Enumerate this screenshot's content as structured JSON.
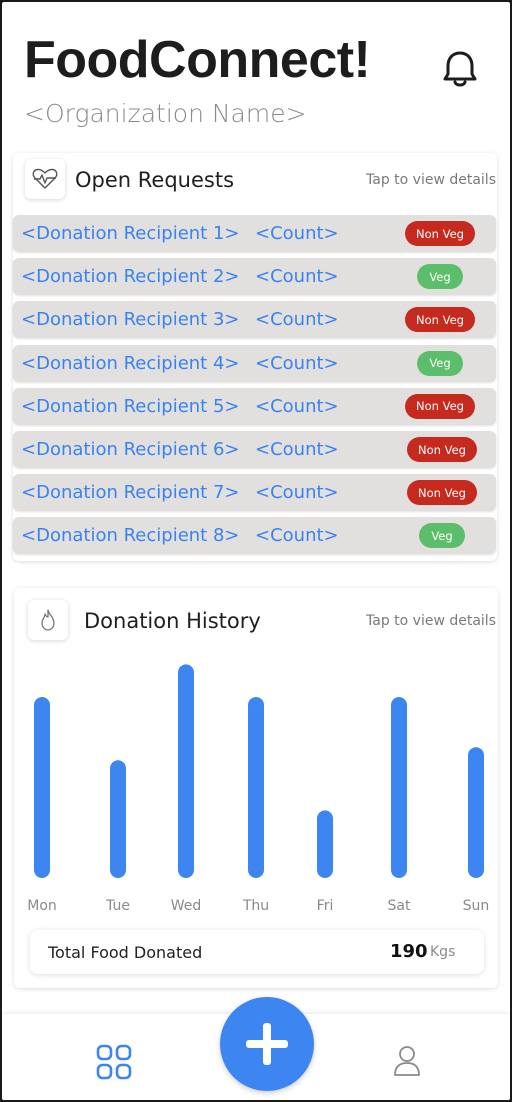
{
  "header": {
    "app_title": "FoodConnect!",
    "org_name": "<Organization Name>"
  },
  "requests": {
    "title": "Open Requests",
    "hint": "Tap to view details",
    "items": [
      {
        "recipient": "<Donation Recipient 1>",
        "count": "<Count>",
        "tag": "Non Veg",
        "kind": "nonveg"
      },
      {
        "recipient": "<Donation Recipient 2>",
        "count": "<Count>",
        "tag": "Veg",
        "kind": "veg"
      },
      {
        "recipient": "<Donation Recipient 3>",
        "count": "<Count>",
        "tag": "Non Veg",
        "kind": "nonveg"
      },
      {
        "recipient": "<Donation Recipient 4>",
        "count": "<Count>",
        "tag": "Veg",
        "kind": "veg"
      },
      {
        "recipient": "<Donation Recipient 5>",
        "count": "<Count>",
        "tag": "Non Veg",
        "kind": "nonveg"
      },
      {
        "recipient": "<Donation Recipient 6>",
        "count": "<Count>",
        "tag": "Non Veg",
        "kind": "nonveg"
      },
      {
        "recipient": "<Donation Recipient 7>",
        "count": "<Count>",
        "tag": "Non Veg",
        "kind": "nonveg"
      },
      {
        "recipient": "<Donation Recipient 8>",
        "count": "<Count>",
        "tag": "Veg",
        "kind": "veg"
      }
    ]
  },
  "history": {
    "title": "Donation History",
    "hint": "Tap to view details",
    "total_label": "Total Food Donated",
    "total_value": "190",
    "total_unit": "Kgs"
  },
  "chart_data": {
    "type": "bar",
    "categories": [
      "Mon",
      "Tue",
      "Wed",
      "Thu",
      "Fri",
      "Sat",
      "Sun"
    ],
    "values": [
      0.83,
      0.54,
      0.98,
      0.83,
      0.31,
      0.83,
      0.6
    ],
    "color": "#3d86f2"
  },
  "colors": {
    "accent": "#3d86f2",
    "non_veg": "#c62a1f",
    "veg": "#5cbd6a",
    "link": "#3a82f0"
  },
  "icons": {
    "header": "bell-icon",
    "requests": "heartbeat-icon",
    "history": "flame-icon",
    "nav_left": "grid-icon",
    "fab": "plus-icon",
    "nav_right": "profile-icon"
  }
}
